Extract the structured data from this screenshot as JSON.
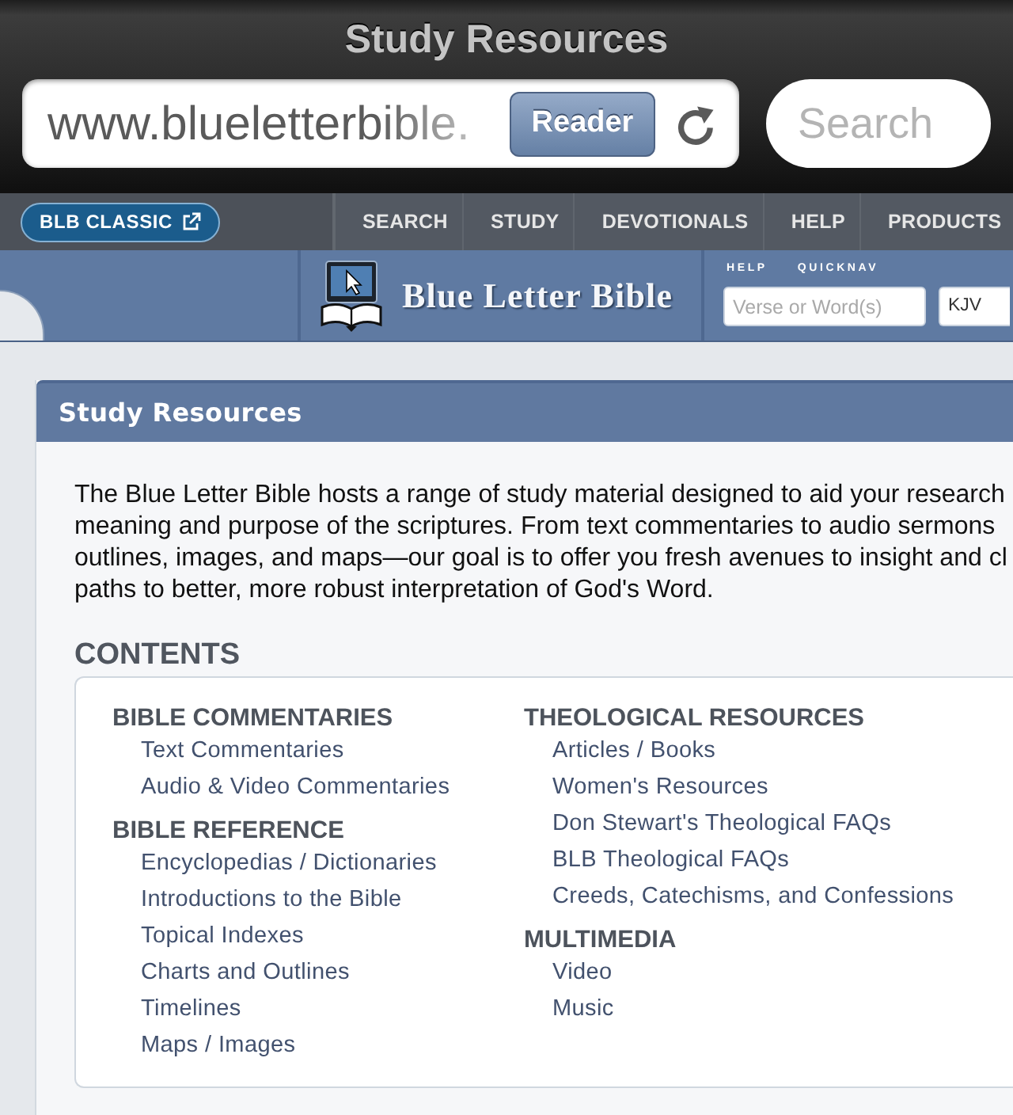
{
  "browser": {
    "title": "Study Resources",
    "address": "www.blueletterbible.",
    "reader_button": "Reader",
    "search": {
      "placeholder": "Search"
    }
  },
  "site_nav": {
    "classic_button": "BLB CLASSIC",
    "items": [
      "SEARCH",
      "STUDY",
      "DEVOTIONALS",
      "HELP",
      "PRODUCTS"
    ]
  },
  "site_header": {
    "logo_text": "Blue Letter Bible",
    "quicknav_labels": [
      "HELP",
      "QUICKNAV"
    ],
    "search": {
      "placeholder": "Verse or Word(s)"
    },
    "version": "KJV"
  },
  "panel": {
    "title": "Study Resources",
    "intro_lines": [
      "The Blue Letter Bible hosts a range of study material designed to aid your research",
      "meaning and purpose of the scriptures. From text commentaries to audio sermons",
      "outlines, images, and maps—our goal is to offer you fresh avenues to insight and cl",
      "paths to better, more robust interpretation of God's Word."
    ],
    "contents": {
      "heading": "CONTENTS",
      "columns": [
        [
          {
            "heading": "BIBLE COMMENTARIES",
            "links": [
              "Text Commentaries",
              "Audio & Video Commentaries"
            ]
          },
          {
            "heading": "BIBLE REFERENCE",
            "links": [
              "Encyclopedias / Dictionaries",
              "Introductions to the Bible",
              "Topical Indexes",
              "Charts and Outlines",
              "Timelines",
              "Maps / Images"
            ]
          }
        ],
        [
          {
            "heading": "THEOLOGICAL RESOURCES",
            "links": [
              "Articles / Books",
              "Women's Resources",
              "Don Stewart's Theological FAQs",
              "BLB Theological FAQs",
              "Creeds, Catechisms, and Confessions"
            ]
          },
          {
            "heading": "MULTIMEDIA",
            "links": [
              "Video",
              "Music"
            ]
          }
        ]
      ]
    }
  }
}
